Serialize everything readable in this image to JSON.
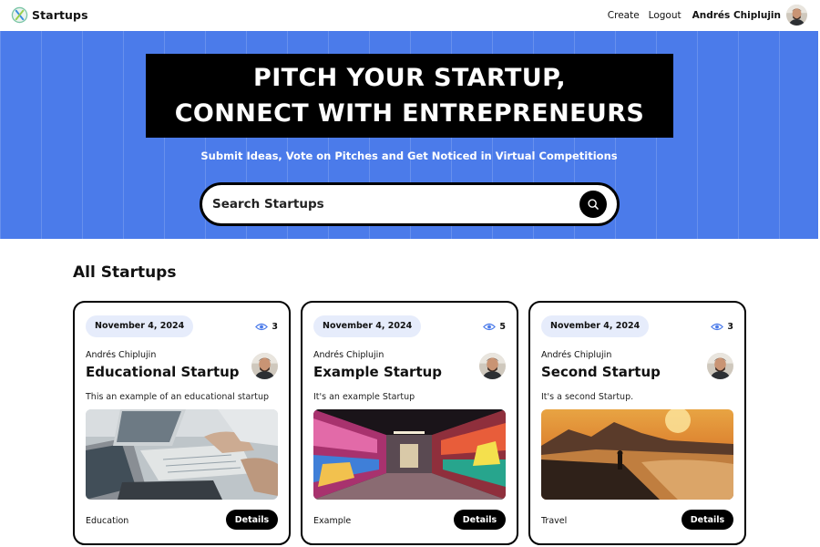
{
  "nav": {
    "brand": "Startups",
    "links": {
      "create": "Create",
      "logout": "Logout"
    },
    "user_name": "Andrés Chiplujin"
  },
  "hero": {
    "title_line1": "PITCH YOUR STARTUP,",
    "title_line2": "CONNECT WITH ENTREPRENEURS",
    "subtitle": "Submit Ideas, Vote on Pitches and Get Noticed in Virtual Competitions",
    "search_placeholder": "Search Startups"
  },
  "section_title": "All Startups",
  "details_label": "Details",
  "cards": [
    {
      "date": "November 4, 2024",
      "views": "3",
      "author": "Andrés Chiplujin",
      "title": "Educational Startup",
      "description": "This an example of an educational startup",
      "category": "Education",
      "image": "office-laptop-paperwork-photo"
    },
    {
      "date": "November 4, 2024",
      "views": "5",
      "author": "Andrés Chiplujin",
      "title": "Example Startup",
      "description": "It's an example Startup",
      "category": "Example",
      "image": "graffiti-tunnel-photo"
    },
    {
      "date": "November 4, 2024",
      "views": "3",
      "author": "Andrés Chiplujin",
      "title": "Second Startup",
      "description": "It's a second Startup.",
      "category": "Travel",
      "image": "sunset-coast-photo"
    }
  ],
  "colors": {
    "hero_bg": "#4b7bea",
    "badge_bg": "#e6ecfb",
    "eye_icon": "#4b7bea"
  },
  "icons": [
    "startup-logo-icon",
    "search-icon",
    "eye-icon"
  ]
}
